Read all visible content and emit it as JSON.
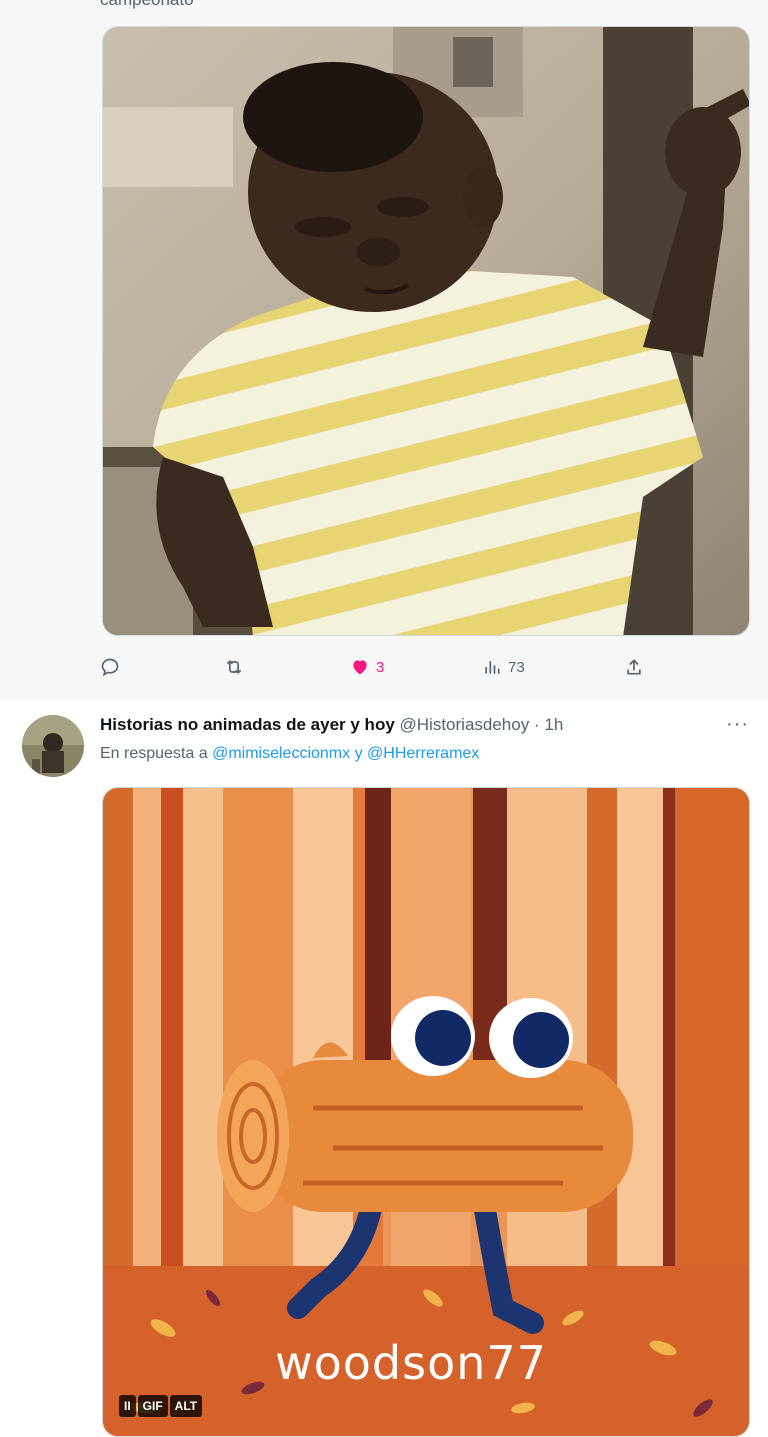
{
  "tweet1": {
    "cut_text": "campeonato",
    "media": {
      "alt": "kid-meme-image"
    },
    "actions": {
      "reply_count": "",
      "retweet_count": "",
      "like_count": "3",
      "views_count": "73"
    }
  },
  "tweet2": {
    "display_name": "Historias no animadas de ayer y hoy",
    "handle": "@Historiasdehoy",
    "separator": "·",
    "time": "1h",
    "more": "···",
    "reply_prefix": "En respuesta a",
    "reply_mention_1": "@mimiseleccionmx",
    "reply_and": "y",
    "reply_mention_2": "@HHerreramex",
    "gif": {
      "watermark": "woodson77",
      "pause_label": "II",
      "gif_label": "GIF",
      "alt_label": "ALT"
    }
  },
  "colors": {
    "like": "#f91880",
    "link": "#1d9bf0",
    "muted": "#536471"
  }
}
